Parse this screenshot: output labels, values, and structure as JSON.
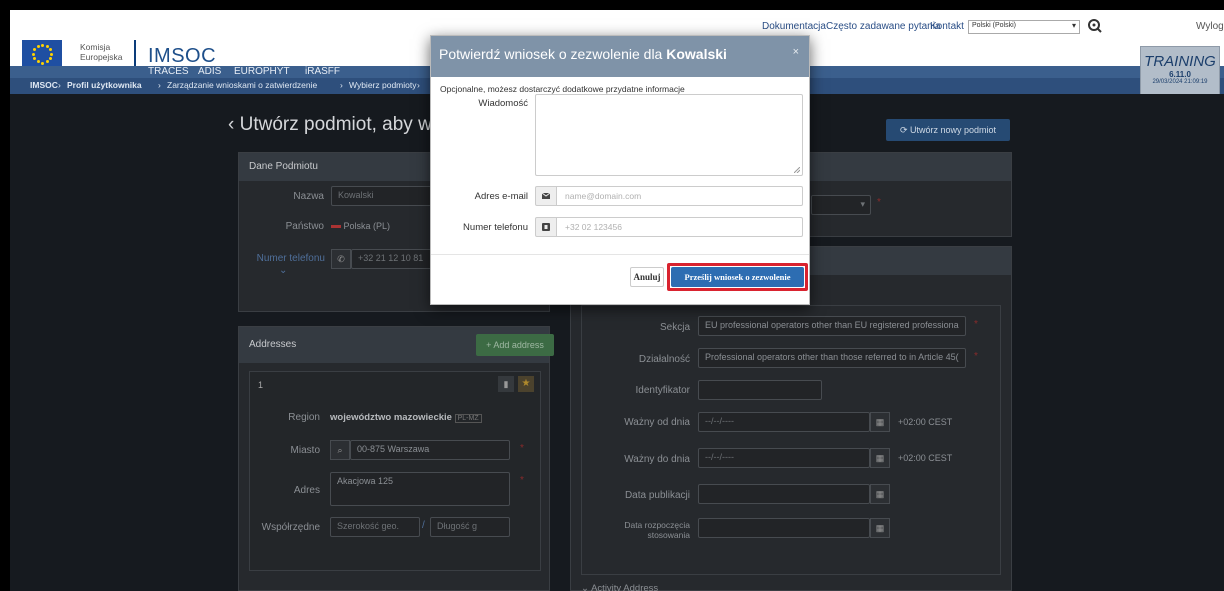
{
  "toplinks": {
    "docs": "Dokumentacja",
    "faq": "Często zadawane pytania",
    "contact": "Kontakt",
    "language": "Polski (Polski)",
    "logout": "Wylogu"
  },
  "brand": {
    "commission": "Komisja",
    "commission2": "Europejska",
    "app": "IMSOC"
  },
  "subnav": [
    "TRACES",
    "ADIS",
    "EUROPHYT",
    "iRASFF"
  ],
  "breadcrumb": [
    "IMSOC",
    "Profil użytkownika",
    "Zarządzanie wnioskami o zatwierdzenie",
    "Wybierz podmioty"
  ],
  "training": {
    "label": "TRAINING",
    "version": "6.11.0",
    "date": "29/03/2024 21:09:19"
  },
  "page": {
    "title": "Utwórz podmiot, aby wr",
    "create_button": "Utwórz nowy podmiot",
    "operator_panel": {
      "title": "Dane Podmiotu",
      "name_label": "Nazwa",
      "name_value": "Kowalski",
      "country_label": "Państwo",
      "country_value": "Polska (PL)",
      "phone_label": "Numer telefonu",
      "phone_placeholder": "+32 21 12 10 81"
    },
    "addresses_panel": {
      "title": "Addresses",
      "add_button": "+ Add address",
      "index": "1",
      "region_label": "Region",
      "region_value": "województwo mazowieckie",
      "region_code": "PL-MZ",
      "city_label": "Miasto",
      "city_value": "00-875 Warszawa",
      "address_label": "Adres",
      "address_value": "Akacjowa 125",
      "coords_label": "Współrzędne",
      "lat_placeholder": "Szerokość geo.",
      "lon_placeholder": "Długość g"
    },
    "activity_panel": {
      "section_label": "Sekcja",
      "section_value": "EU professional operators other than EU registered professiona",
      "activity_label": "Działalność",
      "activity_value": "Professional operators other than those referred to in Article 45(",
      "identifier_label": "Identyfikator",
      "valid_from_label": "Ważny od dnia",
      "valid_to_label": "Ważny do dnia",
      "date_placeholder": "--/--/----",
      "timezone": "+02:00 CEST",
      "publication_label": "Data publikacji",
      "start_label": "Data rozpoczęcia stosowania",
      "activity_address": "Activity Address"
    }
  },
  "modal": {
    "title_prefix": "Potwierdź wniosek o zezwolenie dla ",
    "title_name": "Kowalski",
    "note": "Opcjonalne, możesz dostarczyć dodatkowe przydatne informacje",
    "message_label": "Wiadomość",
    "email_label": "Adres e-mail",
    "email_placeholder": "name@domain.com",
    "phone_label": "Numer telefonu",
    "phone_placeholder": "+32 02 123456",
    "cancel": "Anuluj",
    "submit": "Prześlij wniosek o zezwolenie"
  }
}
